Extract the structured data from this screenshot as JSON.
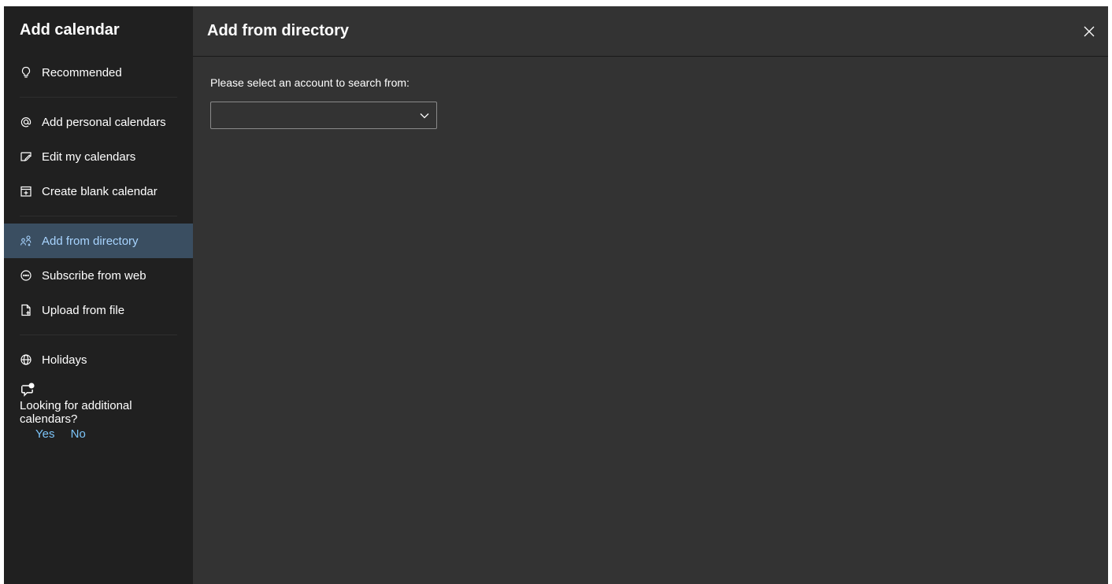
{
  "sidebar": {
    "title": "Add calendar",
    "groups": [
      [
        {
          "label": "Recommended",
          "icon": "lightbulb-icon"
        }
      ],
      [
        {
          "label": "Add personal calendars",
          "icon": "at-sign-icon"
        },
        {
          "label": "Edit my calendars",
          "icon": "edit-calendar-icon"
        },
        {
          "label": "Create blank calendar",
          "icon": "calendar-add-icon"
        }
      ],
      [
        {
          "label": "Add from directory",
          "icon": "people-search-icon",
          "active": true
        },
        {
          "label": "Subscribe from web",
          "icon": "link-circle-icon"
        },
        {
          "label": "Upload from file",
          "icon": "file-upload-icon"
        }
      ],
      [
        {
          "label": "Holidays",
          "icon": "globe-icon"
        }
      ]
    ],
    "feedback": {
      "icon": "chat-feedback-icon",
      "text": "Looking for additional calendars?",
      "yes_label": "Yes",
      "no_label": "No"
    }
  },
  "main": {
    "title": "Add from directory",
    "close_icon": "close-icon",
    "account_label": "Please select an account to search from:",
    "account_select": {
      "value": "",
      "icon": "chevron-down-icon"
    }
  },
  "colors": {
    "sidebar_bg": "#202020",
    "main_bg": "#333333",
    "active_bg": "#3a4e61",
    "active_text": "#a8d4ff",
    "link": "#7cc4f8"
  }
}
